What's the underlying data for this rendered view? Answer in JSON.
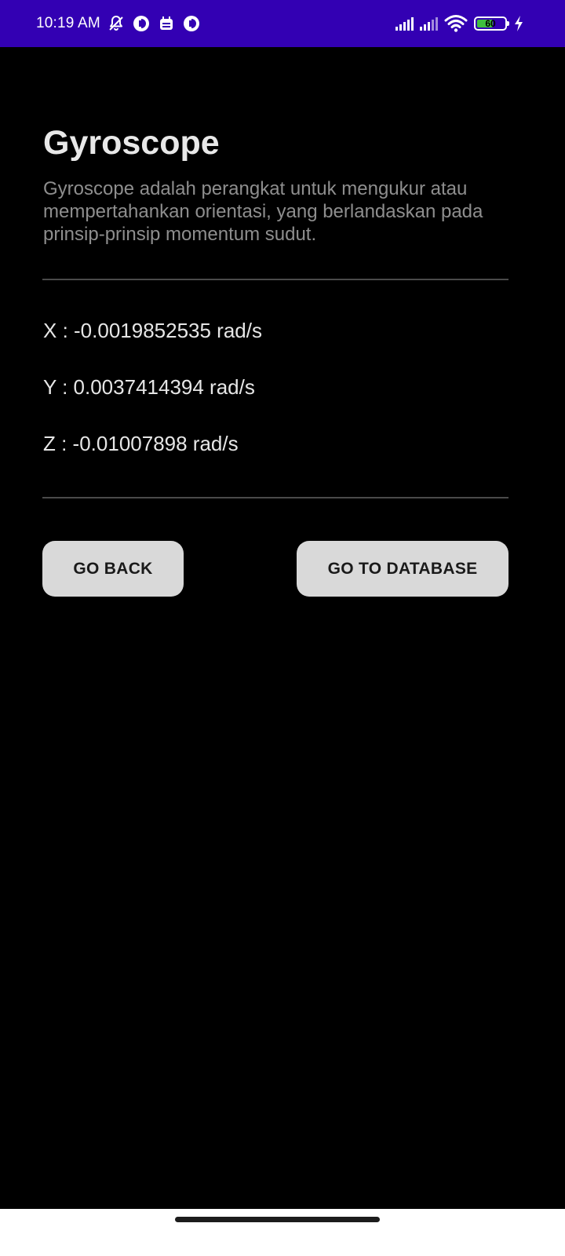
{
  "status_bar": {
    "time": "10:19 AM",
    "battery_level": "60",
    "battery_fraction": 0.6,
    "icons_left": [
      "notifications-off-icon",
      "app-notification-icon",
      "calendar-icon",
      "app-notification-icon"
    ],
    "icons_right": [
      "signal-sim1-icon",
      "signal-sim2-icon",
      "wifi-icon",
      "battery-icon",
      "charging-icon"
    ],
    "background_color": "#3300b3"
  },
  "main": {
    "title": "Gyroscope",
    "description": "Gyroscope adalah perangkat untuk mengukur atau mempertahankan orientasi, yang berlandaskan pada prinsip-prinsip momentum sudut.",
    "readings": {
      "x": "X : -0.0019852535 rad/s",
      "y": "Y : 0.0037414394 rad/s",
      "z": "Z : -0.01007898 rad/s"
    },
    "buttons": {
      "back_label": "GO BACK",
      "database_label": "GO TO DATABASE"
    }
  },
  "colors": {
    "background": "#000000",
    "button_bg": "#d9d9d9",
    "title_text": "#e8e8e8",
    "description_text": "#8e8e8e"
  }
}
